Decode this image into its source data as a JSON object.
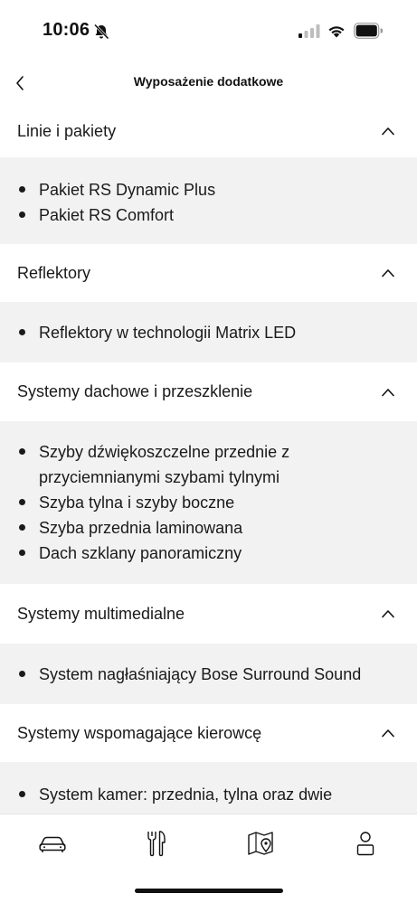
{
  "status_bar": {
    "time": "10:06"
  },
  "header": {
    "title": "Wyposażenie dodatkowe",
    "back_icon": "chevron-left-icon"
  },
  "sections": [
    {
      "title": "Linie i pakiety",
      "items": [
        "Pakiet RS Dynamic Plus",
        "Pakiet RS Comfort"
      ]
    },
    {
      "title": "Reflektory",
      "items": [
        "Reflektory w technologii Matrix LED"
      ]
    },
    {
      "title": "Systemy dachowe i przeszklenie",
      "items": [
        "Szyby dźwiękoszczelne przednie z przyciemnianymi szybami tylnymi",
        "Szyba tylna i szyby boczne",
        "Szyba przednia laminowana",
        "Dach szklany panoramiczny"
      ]
    },
    {
      "title": "Systemy multimedialne",
      "items": [
        "System nagłaśniający Bose Surround Sound"
      ]
    },
    {
      "title": "Systemy wspomagające kierowcę",
      "items": [
        "System kamer: przednia, tylna oraz dwie"
      ]
    }
  ],
  "tab_bar": {
    "tabs": [
      {
        "icon": "car-icon"
      },
      {
        "icon": "service-tools-icon"
      },
      {
        "icon": "map-pin-icon"
      },
      {
        "icon": "profile-icon"
      }
    ]
  },
  "colors": {
    "section_body_bg": "#f2f2f2",
    "text": "#1a1a1a",
    "accent": "#111111"
  }
}
